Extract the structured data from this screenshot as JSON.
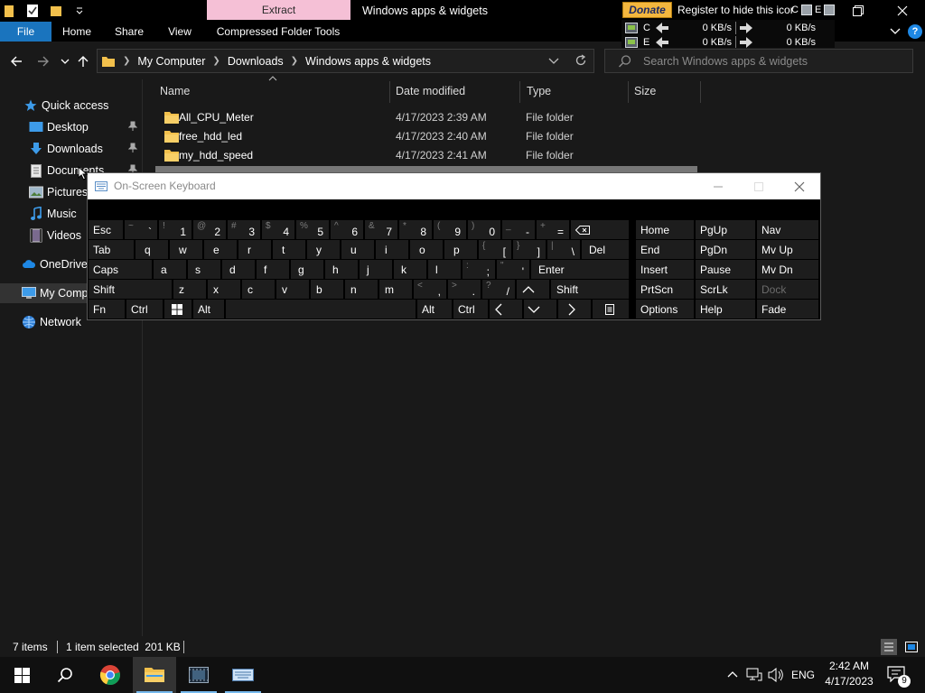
{
  "titlebar": {
    "contextual_group": "Extract",
    "window_title": "Windows apps & widgets",
    "donate": "Donate",
    "register": "Register to hide this icor",
    "drive_tags": [
      "C",
      "E"
    ]
  },
  "ribbon": {
    "tabs": [
      "File",
      "Home",
      "Share",
      "View",
      "Compressed Folder Tools"
    ],
    "help": "?"
  },
  "netmeter": {
    "rows": [
      {
        "drive": "C",
        "down": "0 KB/s",
        "up": "0 KB/s"
      },
      {
        "drive": "E",
        "down": "0 KB/s",
        "up": "0 KB/s"
      }
    ]
  },
  "address": {
    "crumbs": [
      "My Computer",
      "Downloads",
      "Windows apps & widgets"
    ],
    "search_placeholder": "Search Windows apps & widgets"
  },
  "nav": {
    "items": [
      "Quick access",
      "Desktop",
      "Downloads",
      "Documents",
      "Pictures",
      "Music",
      "Videos",
      "OneDrive",
      "My Computer",
      "Network"
    ]
  },
  "files": {
    "columns": [
      "Name",
      "Date modified",
      "Type",
      "Size"
    ],
    "rows": [
      {
        "name": "All_CPU_Meter",
        "date": "4/17/2023 2:39 AM",
        "type": "File folder",
        "size": ""
      },
      {
        "name": "free_hdd_led",
        "date": "4/17/2023 2:40 AM",
        "type": "File folder",
        "size": ""
      },
      {
        "name": "my_hdd_speed",
        "date": "4/17/2023 2:41 AM",
        "type": "File folder",
        "size": ""
      }
    ]
  },
  "osk": {
    "title": "On-Screen Keyboard"
  },
  "status": {
    "items": "7 items",
    "selected": "1 item selected  201 KB"
  },
  "taskbar": {
    "lang": "ENG",
    "time": "2:42 AM",
    "date": "4/17/2023",
    "notifications": "9"
  },
  "colors": {
    "accent": "#1a74be",
    "context_tab": "#f5c0d6",
    "donate": "#f4b73e",
    "folder": "#f2c04c"
  }
}
